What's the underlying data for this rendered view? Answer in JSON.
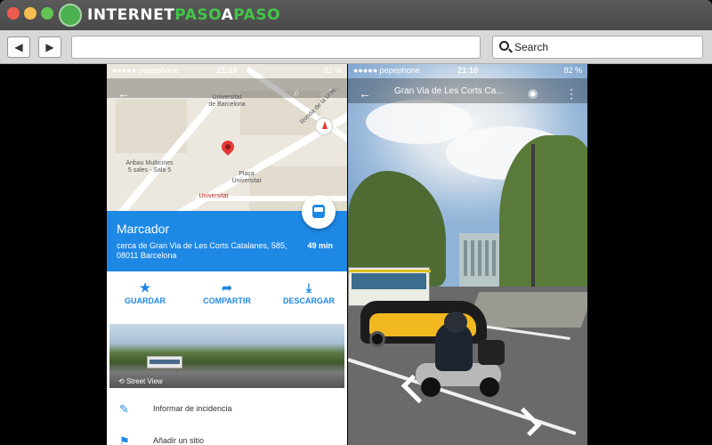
{
  "browser": {
    "logo": {
      "part1": "INTERNET",
      "part2": "PASO",
      "part3": "A",
      "part4": "PASO"
    },
    "nav": {
      "back_icon": "◀",
      "forward_icon": "▶"
    },
    "url": "",
    "search_placeholder": "Search"
  },
  "left_phone": {
    "status": {
      "carrier": "●●●●● pepephone",
      "time": "21:10",
      "battery": "82 %"
    },
    "map": {
      "labels": {
        "university": "Universitat\nde Barcelona",
        "cinema": "Aribau Multicines\n5 sales - Sala 5",
        "square": "Plaça\nUniversitat",
        "metro": "Universitat",
        "street": "Ronda de la Univ..."
      }
    },
    "place": {
      "name": "Marcador",
      "address": "cerca de Gran Via de Les Corts Catalanes, 585, 08011 Barcelona",
      "duration": "49 min"
    },
    "actions": [
      {
        "icon": "★",
        "label": "GUARDAR"
      },
      {
        "icon": "➦",
        "label": "COMPARTIR"
      },
      {
        "icon": "⤓",
        "label": "DESCARGAR"
      }
    ],
    "street_view_label": "Street View",
    "list": [
      {
        "icon": "✎",
        "label": "Informar de incidencia"
      },
      {
        "icon": "⚑",
        "label": "Añadir un sitio"
      }
    ]
  },
  "right_phone": {
    "status": {
      "carrier": "●●●●● pepephone",
      "time": "21:10",
      "battery": "82 %"
    },
    "title": "Gran Via de Les Corts Ca..."
  }
}
